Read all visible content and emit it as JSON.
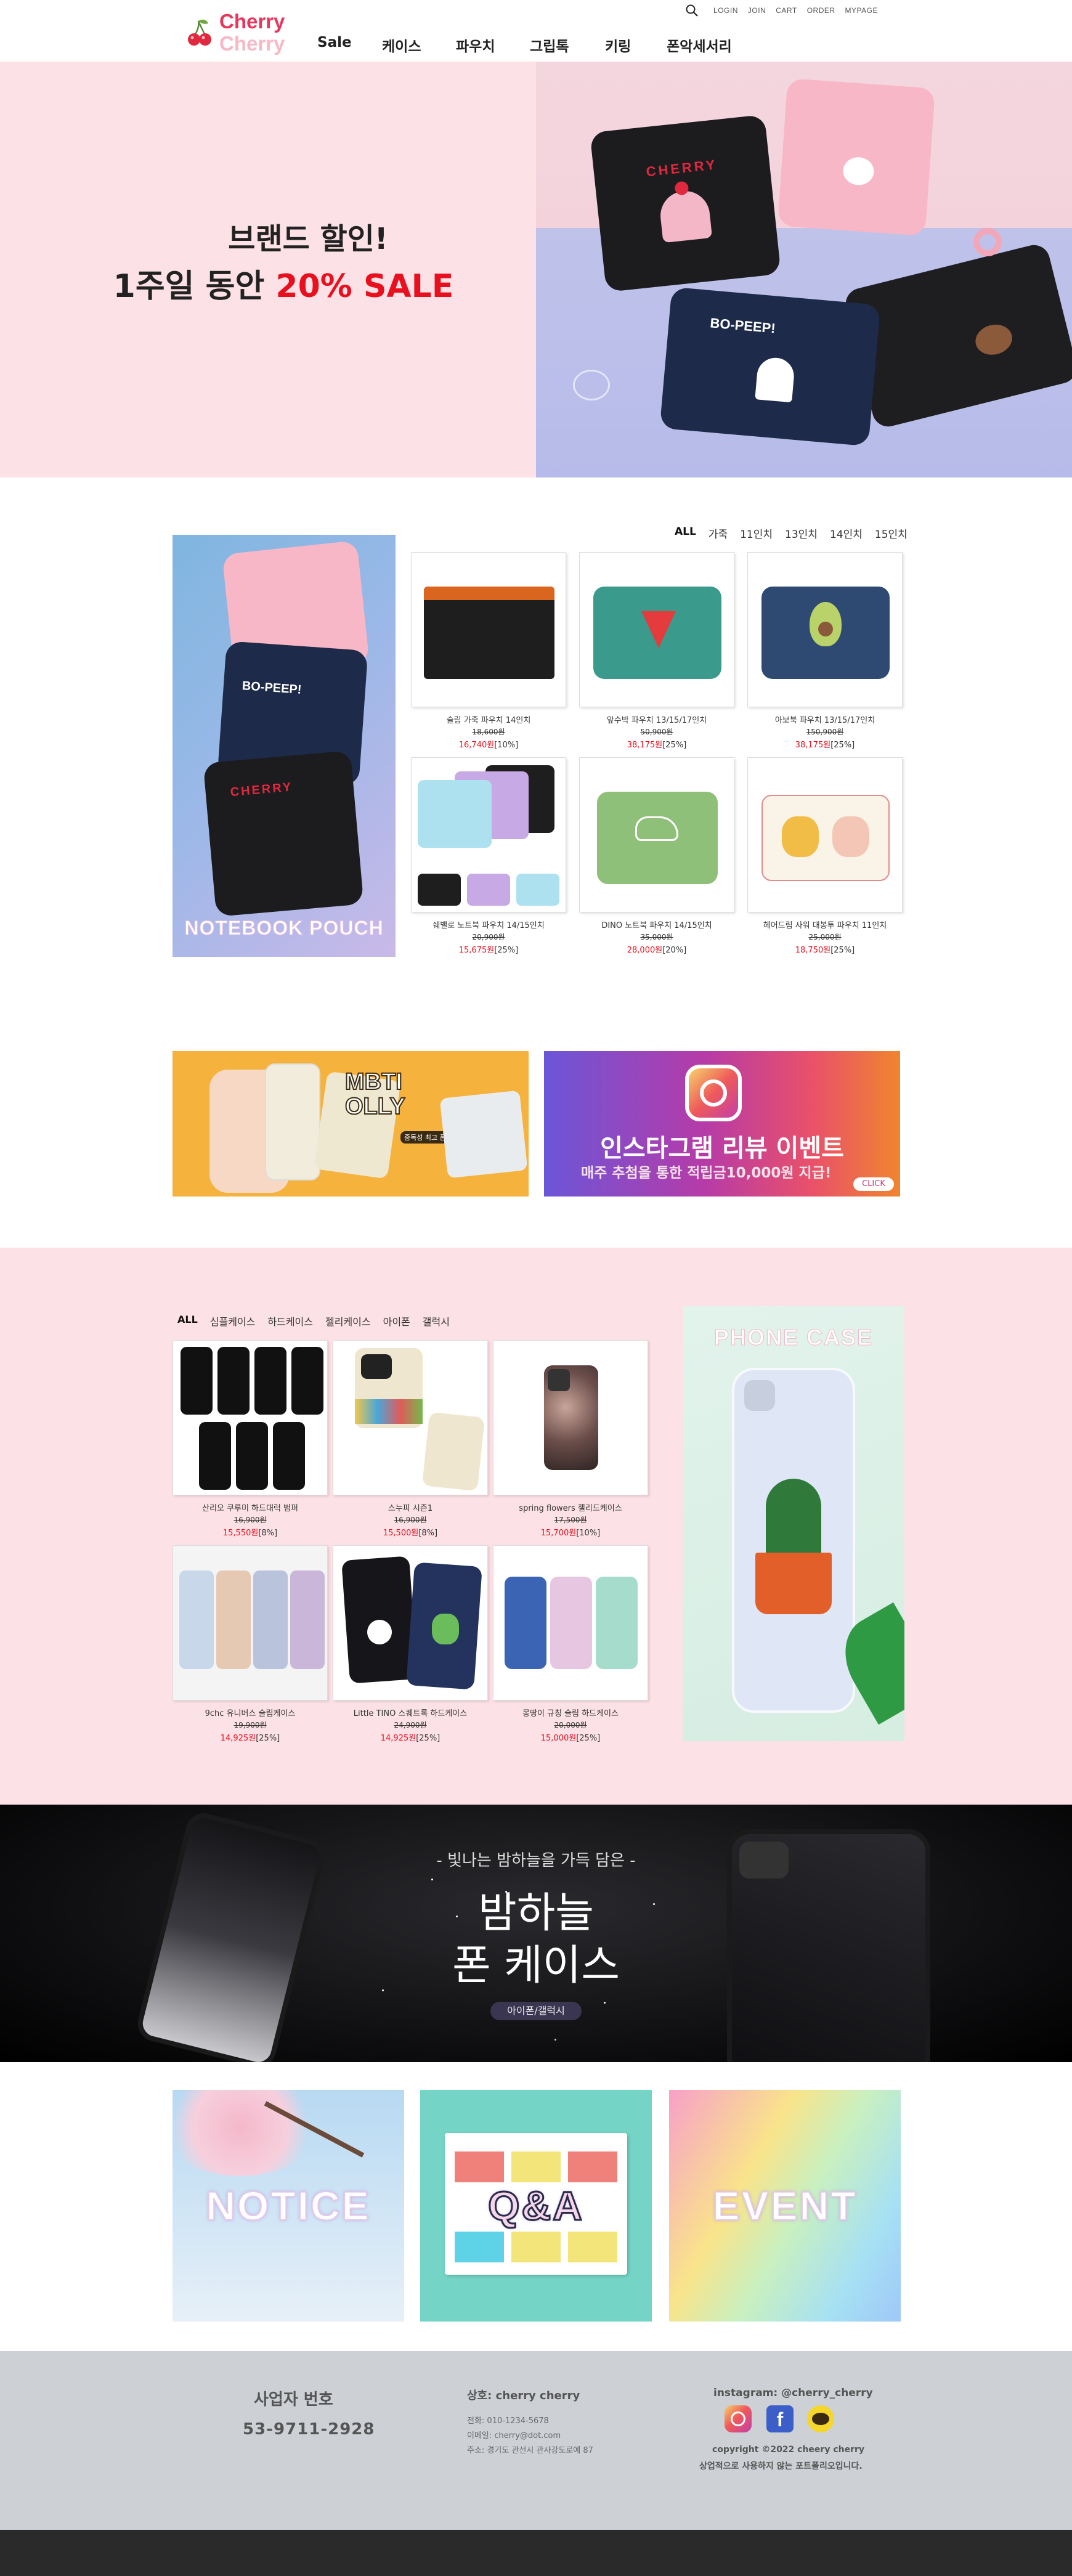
{
  "header": {
    "logo_line1": "Cherry",
    "logo_line2": "Cherry",
    "nav": [
      "Sale",
      "케이스",
      "파우치",
      "그립톡",
      "키링",
      "폰악세서리"
    ],
    "util_links": [
      "LOGIN",
      "JOIN",
      "CART",
      "ORDER",
      "MYPAGE"
    ]
  },
  "hero": {
    "line1": "브랜드 할인!",
    "line2_prefix": "1주일 동안 ",
    "line2_sale": "20% SALE",
    "pouch1_text": "CHERRY",
    "pouch2_text": "BO-PEEP!"
  },
  "pouch_section": {
    "feature_label": "NOTEBOOK POUCH",
    "feature_text": "BO-PEEP!",
    "feature_text2": "CHERRY",
    "tabs": [
      "ALL",
      "가죽",
      "11인치",
      "13인치",
      "14인치",
      "15인치"
    ],
    "products": [
      {
        "name": "슬림 가죽 파우치 14인치",
        "orig": "18,600원",
        "price": "16,740원",
        "pct": "[10%]"
      },
      {
        "name": "앞수박 파우치 13/15/17인치",
        "orig": "50,900원",
        "price": "38,175원",
        "pct": "[25%]"
      },
      {
        "name": "아보북 파우치 13/15/17인치",
        "orig": "150,900원",
        "price": "38,175원",
        "pct": "[25%]"
      },
      {
        "name": "쉐밸로 노트북 파우치 14/15인치",
        "orig": "20,900원",
        "price": "15,675원",
        "pct": "[25%]"
      },
      {
        "name": "DINO 노트북 파우치 14/15인치",
        "orig": "35,000원",
        "price": "28,000원",
        "pct": "[20%]"
      },
      {
        "name": "헤어드림 사워 대봉투 파우치 11인치",
        "orig": "25,000원",
        "price": "18,750원",
        "pct": "[25%]"
      }
    ]
  },
  "banners": {
    "mbti_title": "MBTI OLLY",
    "mbti_sub": "중독성 최고 폰케이스",
    "insta_title": "인스타그램 리뷰 이벤트",
    "insta_sub": "매주 추첨을 통한 적립금10,000원 지급!",
    "insta_click": "CLICK"
  },
  "phone_section": {
    "tabs": [
      "ALL",
      "심플케이스",
      "하드케이스",
      "젤리케이스",
      "아이폰",
      "갤럭시"
    ],
    "feature_label": "PHONE CASE",
    "products": [
      {
        "name": "산리오 쿠루미 하드대럭 범퍼",
        "orig": "16,900원",
        "price": "15,550원",
        "pct": "[8%]"
      },
      {
        "name": "스누피 시즌1",
        "orig": "16,900원",
        "price": "15,500원",
        "pct": "[8%]"
      },
      {
        "name": "spring flowers 젤리드케이스",
        "orig": "17,500원",
        "price": "15,700원",
        "pct": "[10%]"
      },
      {
        "name": "9chc 유니버스 슬림케이스",
        "orig": "19,900원",
        "price": "14,925원",
        "pct": "[25%]"
      },
      {
        "name": "Little TINO 스퀘트록 하드케이스",
        "orig": "24,900원",
        "price": "14,925원",
        "pct": "[25%]"
      },
      {
        "name": "몽땅이 규칭 슬림 하드케이스",
        "orig": "20,000원",
        "price": "15,000원",
        "pct": "[25%]"
      }
    ]
  },
  "night_banner": {
    "sub": "- 빛나는 밤하늘을 가득 담은 -",
    "title1": "밤하늘",
    "title2": "폰 케이스",
    "tag": "아이폰/갤럭시"
  },
  "boxes": {
    "notice": "NOTICE",
    "qna": "Q&A",
    "event": "EVENT"
  },
  "footer": {
    "biz_label": "사업자 번호",
    "biz_number": "53-9711-2928",
    "company": "상호: cherry cherry",
    "phone": "전화: 010-1234-5678",
    "email": "이메일: cherry@dot.com",
    "address": "주소: 경기도 관선시 관사강도로예 87",
    "instagram": "instagram: @cherry_cherry",
    "copyright": "copyright ©2022 cheery cherry",
    "notice": "상업적으로 사용하지 않는 포트폴리오입니다."
  },
  "colors": {
    "brand_pink": "#e8365d",
    "sale_red": "#e8101e",
    "hero_pink": "#fce1e6",
    "footer_gray": "#cdd1d6"
  }
}
